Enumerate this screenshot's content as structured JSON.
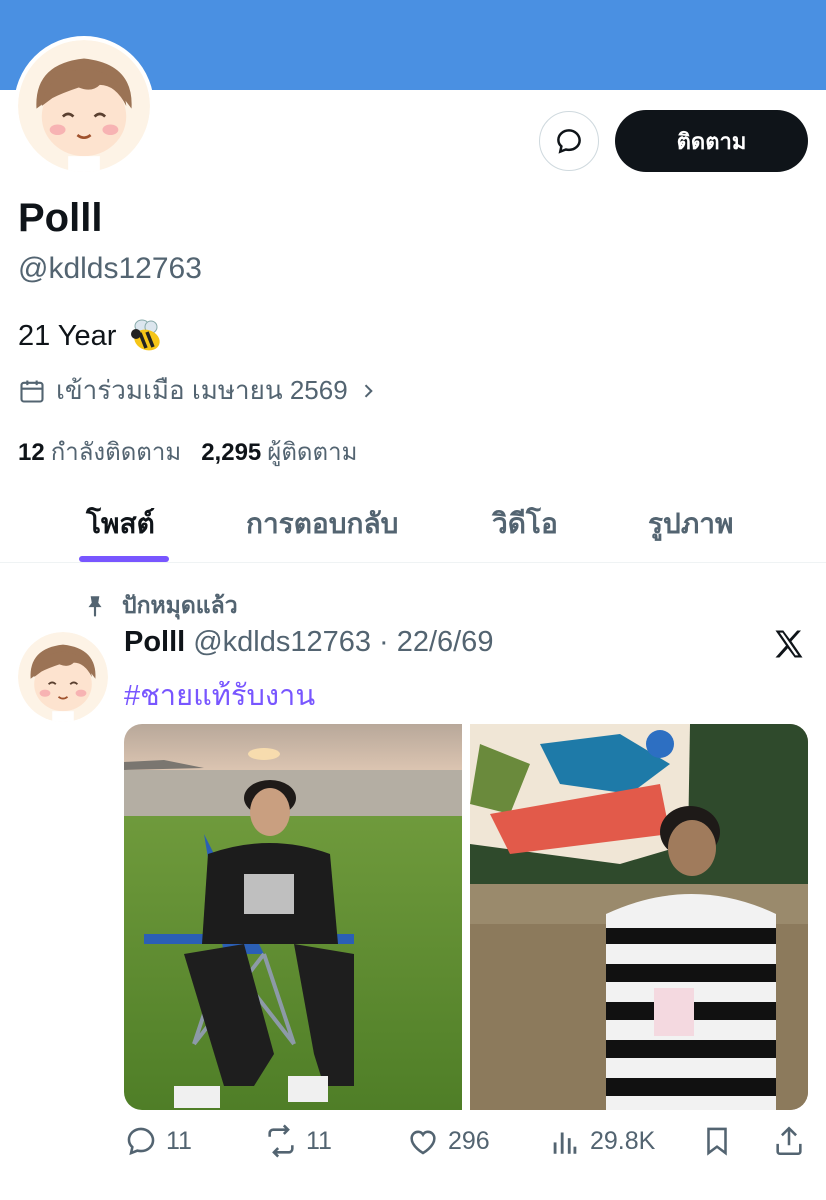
{
  "profile": {
    "name": "Polll",
    "handle": "@kdlds12763",
    "bio": "21 Year",
    "bio_emoji": "bee",
    "joined": "เข้าร่วมเมือ เมษายน 2569",
    "following_count": "12",
    "following_label": "กำลังติดตาม",
    "followers_count": "2,295",
    "followers_label": "ผู้ติดตาม",
    "follow_button": "ติดตาม",
    "banner_color": "#4a90e2"
  },
  "tabs": [
    {
      "label": "โพสต์",
      "active": true
    },
    {
      "label": "การตอบกลับ",
      "active": false
    },
    {
      "label": "วิดีโอ",
      "active": false
    },
    {
      "label": "รูปภาพ",
      "active": false
    }
  ],
  "accent_color": "#7856ff",
  "post": {
    "pinned_label": "ปักหมุดแล้ว",
    "author": "Polll",
    "handle": "@kdlds12763",
    "sep": "·",
    "date": "22/6/69",
    "hashtag": "#ชายแท้รับงาน",
    "stats": {
      "replies": "11",
      "reposts": "11",
      "likes": "296",
      "views": "29.8K"
    }
  },
  "icons": [
    "message-icon",
    "calendar-icon",
    "chevron-right-icon",
    "pin-icon",
    "x-logo-icon",
    "reply-icon",
    "repost-icon",
    "like-icon",
    "views-icon",
    "bookmark-icon",
    "share-icon"
  ]
}
